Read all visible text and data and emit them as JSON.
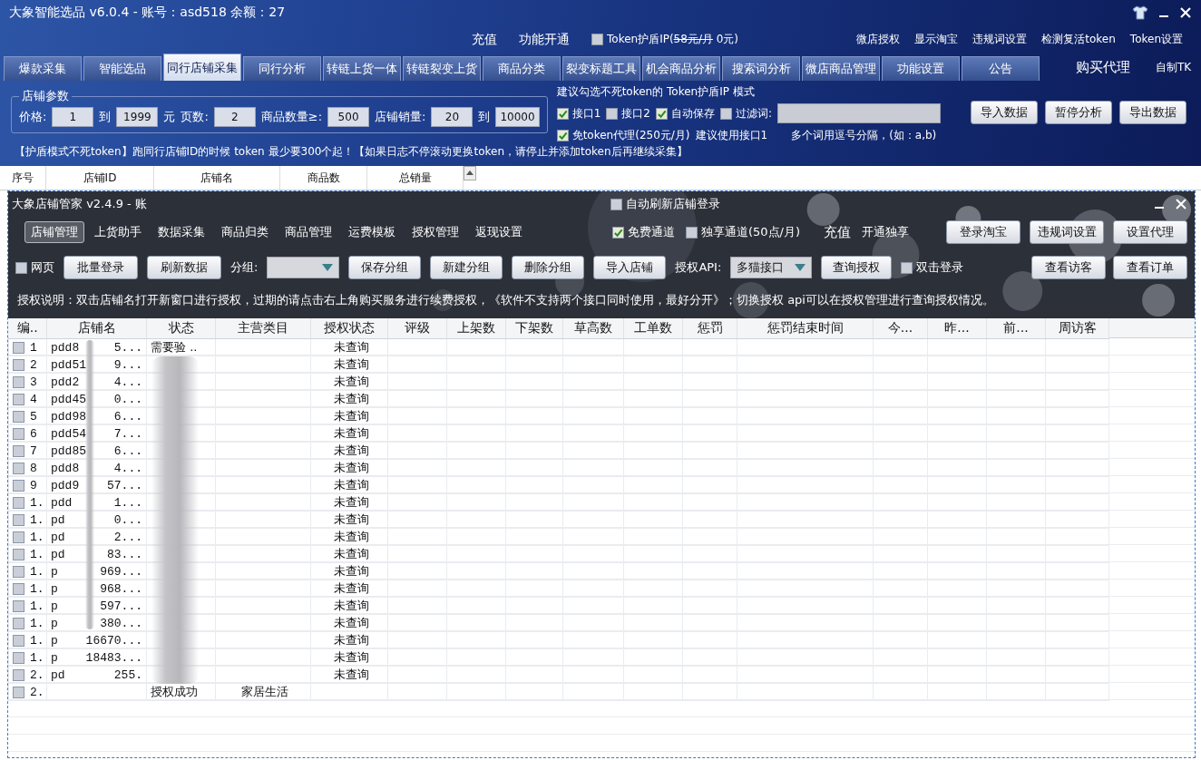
{
  "window": {
    "title": "大象智能选品 v6.0.4 - 账号：asd518 余额：27"
  },
  "top_links": [
    "充值",
    "功能开通"
  ],
  "token_shield": {
    "label": "Token护盾IP(",
    "old_price": "58元/月",
    "price": " 0元)",
    "checked": false
  },
  "right_links": [
    "微店授权",
    "显示淘宝",
    "违规词设置",
    "检测复活token",
    "Token设置"
  ],
  "tabs": [
    {
      "label": "爆款采集",
      "selected": false
    },
    {
      "label": "智能选品",
      "selected": false
    },
    {
      "label": "同行店铺采集",
      "selected": true
    },
    {
      "label": "同行分析",
      "selected": false
    },
    {
      "label": "转链上货一体",
      "selected": false
    },
    {
      "label": "转链裂变上货",
      "selected": false
    },
    {
      "label": "商品分类",
      "selected": false
    },
    {
      "label": "裂变标题工具",
      "selected": false
    },
    {
      "label": "机会商品分析",
      "selected": false
    },
    {
      "label": "搜索词分析",
      "selected": false
    },
    {
      "label": "微店商品管理",
      "selected": false
    },
    {
      "label": "功能设置",
      "selected": false
    },
    {
      "label": "公告",
      "selected": false
    }
  ],
  "extra_links": [
    "购买代理",
    "自制TK"
  ],
  "params": {
    "legend": "店铺参数",
    "price_label": "价格:",
    "price_min": "1",
    "to_1": "到",
    "price_max": "1999",
    "unit": "元",
    "pages_label": "页数:",
    "pages": "2",
    "count_label": "商品数量≥:",
    "count": "500",
    "sales_label": "店铺销量:",
    "sales_min": "20",
    "to_2": "到",
    "sales_max": "10000"
  },
  "token_hint": "建议勾选不死token的  Token护盾IP 模式",
  "options": [
    {
      "label": "接口1",
      "checked": true
    },
    {
      "label": "接口2",
      "checked": false
    },
    {
      "label": "自动保存",
      "checked": true
    },
    {
      "label": "过滤词:",
      "checked": false
    }
  ],
  "proxy_option": {
    "label": "免token代理(250元/月)",
    "checked": true
  },
  "proxy_note": "建议使用接口1",
  "filter_note": "多个词用逗号分隔，(如：a,b)",
  "action_buttons": [
    "导入数据",
    "暂停分析",
    "导出数据"
  ],
  "notice": "【护盾模式不死token】跑同行店铺ID的时候 token 最少要300个起！【如果日志不停滚动更换token，请停止并添加token后再继续采集】",
  "result_columns": [
    "序号",
    "店铺ID",
    "店铺名",
    "商品数",
    "总销量"
  ],
  "shop_manager": {
    "title": "大象店铺管家 v2.4.9 - 账",
    "auto_refresh": {
      "label": "自动刷新店铺登录",
      "checked": false
    },
    "nav": [
      {
        "label": "店铺管理",
        "selected": true
      },
      {
        "label": "上货助手",
        "selected": false
      },
      {
        "label": "数据采集",
        "selected": false
      },
      {
        "label": "商品归类",
        "selected": false
      },
      {
        "label": "商品管理",
        "selected": false
      },
      {
        "label": "运费模板",
        "selected": false
      },
      {
        "label": "授权管理",
        "selected": false
      },
      {
        "label": "返现设置",
        "selected": false
      }
    ],
    "channels": [
      {
        "label": "免费通道",
        "checked": true
      },
      {
        "label": "独享通道(50点/月)",
        "checked": false
      }
    ],
    "links": [
      "充值",
      "开通独享"
    ],
    "top_buttons": [
      "登录淘宝",
      "违规词设置",
      "设置代理"
    ],
    "web_option": {
      "label": "网页",
      "checked": false
    },
    "login_buttons": [
      "批量登录",
      "刷新数据"
    ],
    "group_label": "分组:",
    "group_buttons": [
      "保存分组",
      "新建分组",
      "删除分组",
      "导入店铺"
    ],
    "api_label": "授权API:",
    "api_value": "多猫接口",
    "query_button": "查询授权",
    "double_click": {
      "label": "双击登录",
      "checked": false
    },
    "right_buttons": [
      "查看访客",
      "查看订单"
    ],
    "info": "授权说明：双击店铺名打开新窗口进行授权，过期的请点击右上角购买服务进行续费授权，《软件不支持两个接口同时使用，最好分开》；切换授权 api可以在授权管理进行查询授权情况。",
    "columns": [
      "编..",
      "店铺名",
      "状态",
      "主营类目",
      "授权状态",
      "评级",
      "上架数",
      "下架数",
      "草高数",
      "工单数",
      "惩罚",
      "惩罚结束时间",
      "今...",
      "昨...",
      "前...",
      "周访客"
    ],
    "rows": [
      {
        "number": "1",
        "name_start": "pdd8",
        "name_end": "5...",
        "status": "需要验 ..",
        "auth": "未查询",
        "checked": false
      },
      {
        "number": "2",
        "name_start": "pdd51",
        "name_end": "9...",
        "auth": "未查询",
        "checked": false
      },
      {
        "number": "3",
        "name_start": "pdd2",
        "name_end": "4...",
        "auth": "未查询",
        "checked": false
      },
      {
        "number": "4",
        "name_start": "pdd45",
        "name_end": "0...",
        "auth": "未查询",
        "checked": false
      },
      {
        "number": "5",
        "name_start": "pdd98",
        "name_end": "6...",
        "auth": "未查询",
        "checked": false
      },
      {
        "number": "6",
        "name_start": "pdd54",
        "name_end": "7...",
        "auth": "未查询",
        "checked": false
      },
      {
        "number": "7",
        "name_start": "pdd85",
        "name_end": "6...",
        "auth": "未查询",
        "checked": false
      },
      {
        "number": "8",
        "name_start": "pdd8",
        "name_end": "4...",
        "auth": "未查询",
        "checked": false
      },
      {
        "number": "9",
        "name_start": "pdd9",
        "name_end": "57...",
        "auth": "未查询",
        "checked": false
      },
      {
        "number": "1.",
        "name_start": "pdd",
        "name_end": "1...",
        "auth": "未查询",
        "checked": false
      },
      {
        "number": "1.",
        "name_start": "pd",
        "name_end": "0...",
        "auth": "未查询",
        "checked": false
      },
      {
        "number": "1.",
        "name_start": "pd",
        "name_end": "2...",
        "auth": "未查询",
        "checked": false
      },
      {
        "number": "1.",
        "name_start": "pd",
        "name_end": "83...",
        "auth": "未查询",
        "checked": false
      },
      {
        "number": "1.",
        "name_start": "p",
        "name_end": "969...",
        "auth": "未查询",
        "checked": false
      },
      {
        "number": "1.",
        "name_start": "p",
        "name_end": "968...",
        "auth": "未查询",
        "checked": false
      },
      {
        "number": "1.",
        "name_start": "p",
        "name_end": "597...",
        "auth": "未查询",
        "checked": false
      },
      {
        "number": "1.",
        "name_start": "p",
        "name_end": "380...",
        "auth": "未查询",
        "checked": false
      },
      {
        "number": "1.",
        "name_start": "p",
        "name_end": "16670...",
        "auth": "未查询",
        "checked": false
      },
      {
        "number": "1.",
        "name_start": "p",
        "name_end": "18483...",
        "auth": "未查询",
        "checked": false
      },
      {
        "number": "2.",
        "name_start": "pd",
        "name_end": "255.",
        "auth": "未查询",
        "checked": false
      },
      {
        "number": "2.",
        "status": "授权成功",
        "category": "家居生活",
        "checked": false
      }
    ]
  }
}
